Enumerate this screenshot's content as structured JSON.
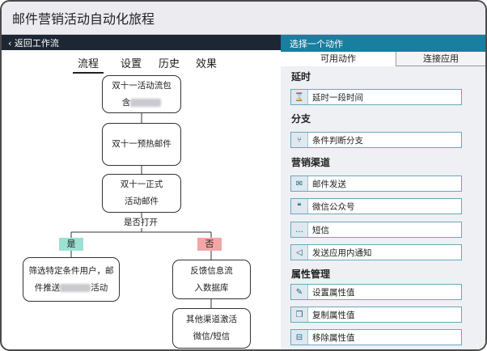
{
  "app": {
    "title": "邮件营销活动自动化旅程"
  },
  "nav": {
    "back_label": "返回工作流"
  },
  "tabs": [
    {
      "label": "流程"
    },
    {
      "label": "设置"
    },
    {
      "label": "历史"
    },
    {
      "label": "效果"
    }
  ],
  "flow": {
    "nodes": [
      {
        "line1": "双十一活动流包",
        "line2_prefix": "含"
      },
      {
        "label": "双十一预热邮件"
      },
      {
        "line1": "双十一正式",
        "line2": "活动邮件"
      },
      {
        "line1": "筛选特定条件用户，邮",
        "line2_prefix": "件推送",
        "line2_suffix": "活动"
      },
      {
        "line1": "反馈信息流",
        "line2": "入数据库"
      },
      {
        "line1": "其他渠道激活",
        "line2": "微信/短信"
      }
    ],
    "decision": {
      "label": "是否打开",
      "yes": "是",
      "no": "否"
    }
  },
  "panel": {
    "title": "选择一个动作",
    "tabs": [
      {
        "label": "可用动作"
      },
      {
        "label": "连接应用"
      }
    ],
    "sections": [
      {
        "title": "延时",
        "items": [
          {
            "label": "延时一段时间",
            "icon": "hourglass-icon",
            "glyph": "⌛"
          }
        ]
      },
      {
        "title": "分支",
        "items": [
          {
            "label": "条件判断分支",
            "icon": "branch-icon",
            "glyph": "⑂"
          }
        ]
      },
      {
        "title": "营销渠道",
        "items": [
          {
            "label": "邮件发送",
            "icon": "mail-icon",
            "glyph": "✉"
          },
          {
            "label": "微信公众号",
            "icon": "wechat-icon",
            "glyph": "❝"
          },
          {
            "label": "短信",
            "icon": "sms-icon",
            "glyph": "…"
          },
          {
            "label": "发送应用内通知",
            "icon": "megaphone-icon",
            "glyph": "◁"
          }
        ]
      },
      {
        "title": "属性管理",
        "items": [
          {
            "label": "设置属性值",
            "icon": "edit-icon",
            "glyph": "✎"
          },
          {
            "label": "复制属性值",
            "icon": "copy-icon",
            "glyph": "❐"
          },
          {
            "label": "移除属性值",
            "icon": "remove-icon",
            "glyph": "⊟"
          }
        ]
      }
    ]
  }
}
